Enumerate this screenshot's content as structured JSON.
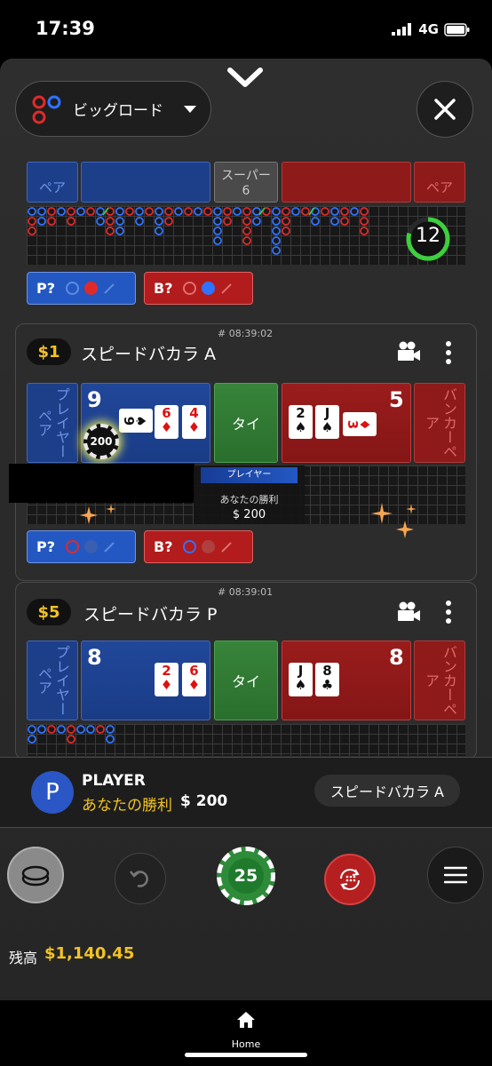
{
  "status_bar": {
    "time": "17:39",
    "network": "4G"
  },
  "header": {
    "view_label": "ビッグロード"
  },
  "top_table": {
    "labels": {
      "player_pair": "ペア",
      "super": "スーパー",
      "super_num": "6",
      "banker_pair": "ペア"
    },
    "timer": "12",
    "prediction": {
      "player": "P?",
      "banker": "B?"
    }
  },
  "tables": [
    {
      "game_id": "# 08:39:02",
      "stake": "$1",
      "name": "スピードバカラ A",
      "player_pair": "プレイヤーペア",
      "tie": "タイ",
      "banker_pair": "バンカーペア",
      "player_score": "9",
      "banker_score": "5",
      "player_cards": [
        {
          "rank": "9",
          "suit": "♠",
          "color": "black",
          "rotated": true
        },
        {
          "rank": "6",
          "suit": "♦",
          "color": "red"
        },
        {
          "rank": "4",
          "suit": "♦",
          "color": "red"
        }
      ],
      "banker_cards": [
        {
          "rank": "2",
          "suit": "♠",
          "color": "black"
        },
        {
          "rank": "J",
          "suit": "♠",
          "color": "black"
        },
        {
          "rank": "3",
          "suit": "♦",
          "color": "red",
          "rotated": true
        }
      ],
      "chip_value": "200",
      "win_banner": {
        "side": "プレイヤー",
        "text": "あなたの勝利",
        "amount": "$ 200"
      },
      "prediction": {
        "player": "P?",
        "banker": "B?"
      }
    },
    {
      "game_id": "# 08:39:01",
      "stake": "$5",
      "name": "スピードバカラ P",
      "player_pair": "プレイヤーペア",
      "tie": "タイ",
      "banker_pair": "バンカーペア",
      "player_score": "8",
      "banker_score": "8",
      "player_cards": [
        {
          "rank": "2",
          "suit": "♦",
          "color": "red"
        },
        {
          "rank": "6",
          "suit": "♦",
          "color": "red"
        }
      ],
      "banker_cards": [
        {
          "rank": "J",
          "suit": "♠",
          "color": "black"
        },
        {
          "rank": "8",
          "suit": "♣",
          "color": "black"
        }
      ]
    }
  ],
  "result": {
    "badge": "P",
    "title": "PLAYER",
    "win_text": "あなたの勝利",
    "amount": "$ 200",
    "table": "スピードバカラ A"
  },
  "controls": {
    "chip": "25"
  },
  "balance": {
    "label": "残高",
    "amount": "$1,140.45"
  },
  "nav": {
    "home_label": "Home"
  },
  "colors": {
    "player": "#2358c2",
    "banker": "#b21c1c",
    "tie": "#2f7d32",
    "gold": "#f3c324",
    "timer": "#3ecf3e"
  }
}
